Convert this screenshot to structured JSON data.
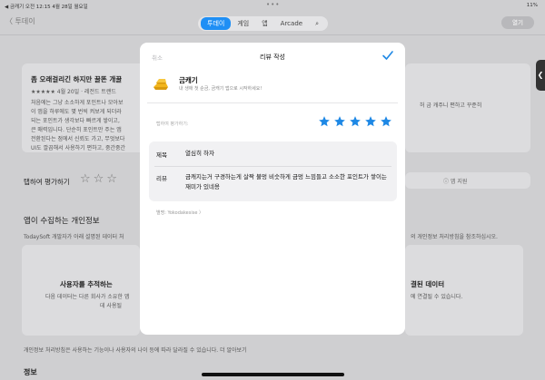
{
  "status": {
    "left": "◀ 금캐기  오전 12:15  4월 28일 월요일",
    "right": "11%"
  },
  "nav": {
    "back": "〈 투데이",
    "tabs": [
      {
        "label": "투데이",
        "active": true
      },
      {
        "label": "게임",
        "active": false
      },
      {
        "label": "앱",
        "active": false
      },
      {
        "label": "Arcade",
        "active": false
      }
    ],
    "search_glyph": "⌕",
    "open_label": "열기"
  },
  "background": {
    "review_title": "좀 오래걸리긴 하지만 꿀똔 개꿀",
    "review_meta": "★★★★★ 4월 20일 · 레전드 트랜드",
    "review_body1": "처음에는 그냥 소소하게 포인트나 모아보",
    "review_body2": "이 앱을 하루에도 몇 번씩 켜보게 되더라",
    "review_body3": "되는 포인트가 생각보다 빠르게 쌓이고,",
    "review_body4": "큰 매력입니다. 단순히 포인트만 주는 앱",
    "review_body5": "전환된다는 점에서 신뢰도 가고, 무엇보다",
    "review_body6": "UI도 깔끔해서 사용하기 편하고, 중간중간",
    "right_snippet": "허 금 캐주니 편하고 꾸준히",
    "rate_label": "탭하여 평가하기",
    "support_label": "ⓘ 앱 지원",
    "privacy_title": "앱이 수집하는 개인정보",
    "privacy_desc": "TodaySoft 개발자가 아래 설명된 데이터 처",
    "privacy_right": "의 개인정보 처리방침을 참조하십시오.",
    "track_title": "사용자를 추적하는",
    "track_desc1": "다음 데이터는 다른 회사가 소유한 앱",
    "track_desc2": "데 사용될",
    "linked_title": "결된 데이터",
    "linked_desc": "에 연결될 수 있습니다.",
    "bottom_note": "개인정보 처리방침은 사용하는 기능이나 사용자의 나이 등에 따라 달라질 수 있습니다. 더 알아보기",
    "bottom_heading": "정보"
  },
  "modal": {
    "cancel": "취소",
    "title": "리뷰 작성",
    "app_name": "금캐기",
    "app_desc": "내 생애 첫 순금, 금캐기 앱으로 시작하세요!",
    "tap_to_rate": "탭하여 평가하기:",
    "rating": 5,
    "title_label": "제목",
    "title_value": "열심히 하자",
    "review_label": "리뷰",
    "review_value": "금캐지는거 구경하는게 살짝 불멍 비슷하게 금멍 느낌들고 소소한 포인트가 쌓이는 재미가 있네용",
    "nickname": "별명: Yokodakesise 〉",
    "accent_color": "#1e88e5"
  }
}
